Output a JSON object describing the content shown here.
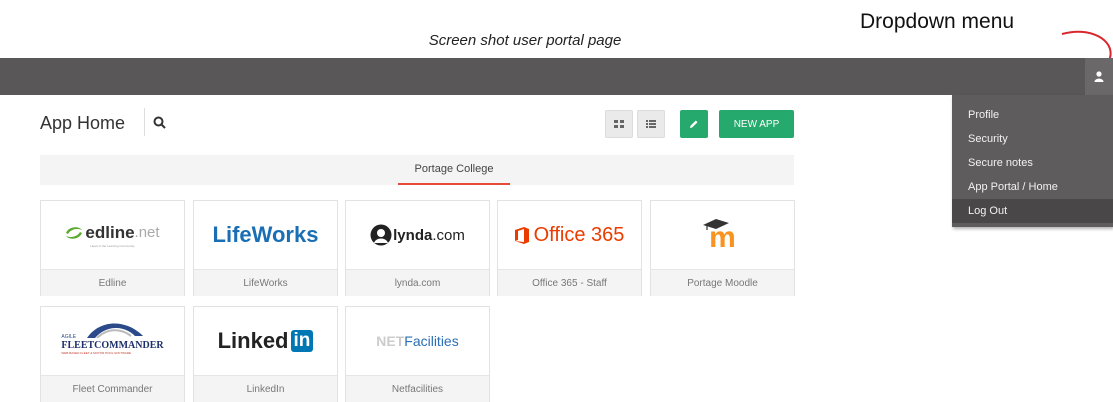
{
  "caption": "Screen shot user portal page",
  "annotation": "Dropdown menu",
  "header": {
    "title": "App Home"
  },
  "toolbar": {
    "new_app_label": "NEW APP"
  },
  "tabs": [
    {
      "label": "Portage College"
    }
  ],
  "user_menu": {
    "items": [
      {
        "label": "Profile"
      },
      {
        "label": "Security"
      },
      {
        "label": "Secure notes"
      },
      {
        "label": "App Portal / Home"
      },
      {
        "label": "Log Out"
      }
    ]
  },
  "apps": [
    {
      "name": "Edline",
      "logo": {
        "brand": "edline",
        "suffix": ".net",
        "tagline": "Heart of the Learning Community"
      }
    },
    {
      "name": "LifeWorks",
      "logo": {
        "text": "LifeWorks"
      }
    },
    {
      "name": "lynda.com",
      "logo": {
        "brand": "lynda",
        "suffix": ".com"
      }
    },
    {
      "name": "Office 365 - Staff",
      "logo": {
        "text": "Office 365"
      }
    },
    {
      "name": "Portage Moodle",
      "logo": {
        "text": "m"
      }
    },
    {
      "name": "Fleet Commander",
      "logo": {
        "top": "AGILE",
        "main": "FLEETCOMMANDER",
        "tagline": "WEB-BASED FLEET & MOTOR POOL SOFTWARE"
      }
    },
    {
      "name": "LinkedIn",
      "logo": {
        "a": "Linked",
        "b": "in"
      }
    },
    {
      "name": "Netfacilities",
      "logo": {
        "a": "NET",
        "b": "Facilities"
      }
    }
  ],
  "colors": {
    "topbar": "#5a5758",
    "accent_green": "#26a96c",
    "tab_underline": "#e44c35",
    "office_red": "#eb3c00",
    "linkedin_blue": "#0077b5",
    "lifeworks_blue": "#1a6fb4",
    "moodle_orange": "#f7931e"
  }
}
